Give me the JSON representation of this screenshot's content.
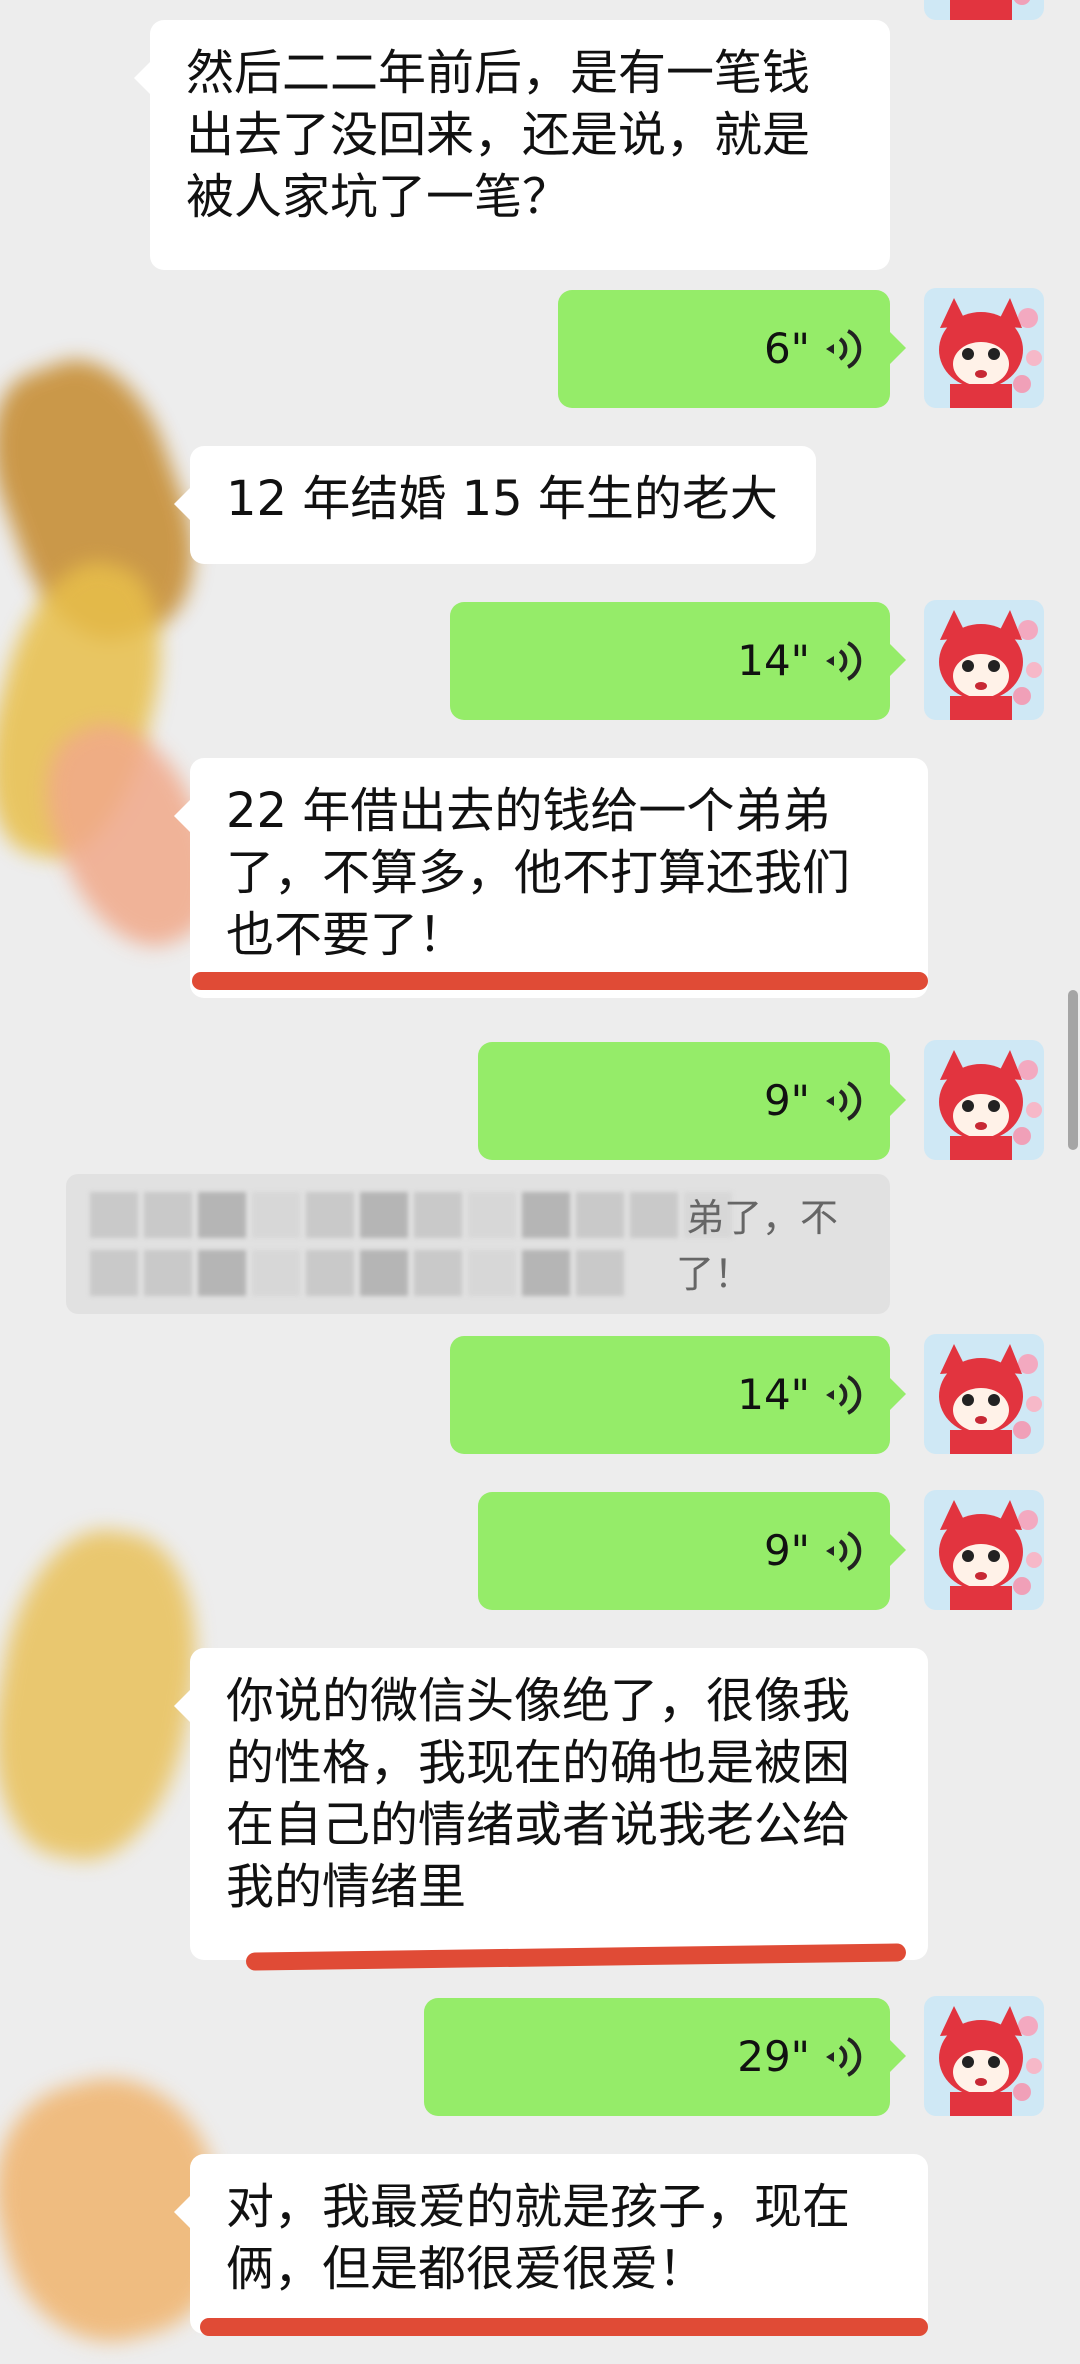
{
  "colors": {
    "background": "#ededed",
    "incoming_bubble": "#ffffff",
    "voice_bubble": "#95ec69",
    "underline": "#e04b36"
  },
  "messages": {
    "m1": {
      "lines": [
        "然后二二年前后，是有一笔钱",
        "出去了没回来，还是说，就是",
        "被人家坑了一笔？"
      ]
    },
    "v1": {
      "duration": "6\"",
      "icon": "voice-wave-icon"
    },
    "m2": {
      "lines": [
        "12 年结婚 15 年生的老大"
      ]
    },
    "v2": {
      "duration": "14\"",
      "icon": "voice-wave-icon"
    },
    "m3": {
      "lines": [
        "22 年借出去的钱给一个弟弟",
        "了，不算多，他不打算还我们",
        "也不要了！"
      ]
    },
    "v3": {
      "duration": "9\"",
      "icon": "voice-wave-icon"
    },
    "quote": {
      "line1_visible": "弟了，不",
      "line2_visible": "了！"
    },
    "v4": {
      "duration": "14\"",
      "icon": "voice-wave-icon"
    },
    "v5": {
      "duration": "9\"",
      "icon": "voice-wave-icon"
    },
    "m4": {
      "lines": [
        "你说的微信头像绝了，很像我",
        "的性格，我现在的确也是被困",
        "在自己的情绪或者说我老公给",
        "我的情绪里"
      ]
    },
    "v6": {
      "duration": "29\"",
      "icon": "voice-wave-icon"
    },
    "m5": {
      "lines": [
        "对，我最爱的就是孩子，现在",
        "俩，但是都很爱很爱！"
      ]
    }
  },
  "avatar": {
    "icon": "red-fox-avatar-icon"
  }
}
